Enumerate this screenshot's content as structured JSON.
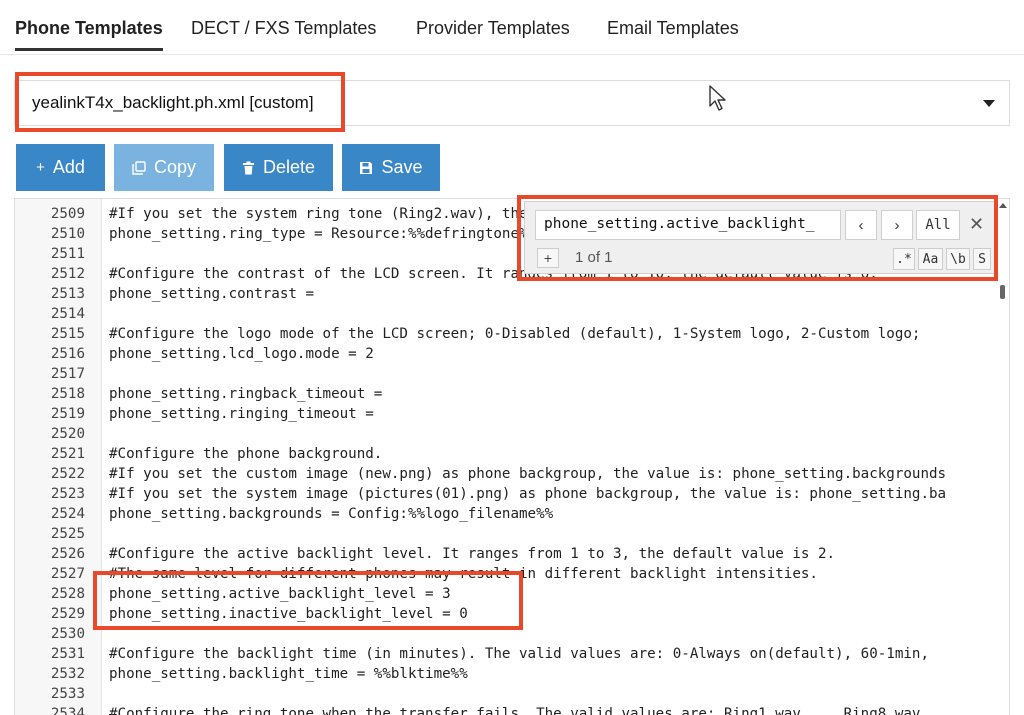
{
  "tabs": [
    {
      "label": "Phone Templates",
      "active": true
    },
    {
      "label": "DECT / FXS Templates"
    },
    {
      "label": "Provider Templates"
    },
    {
      "label": "Email Templates"
    }
  ],
  "template_select": {
    "value": "yealinkT4x_backlight.ph.xml [custom]"
  },
  "toolbar": {
    "add_label": "Add",
    "copy_label": "Copy",
    "delete_label": "Delete",
    "save_label": "Save"
  },
  "search": {
    "query": "phone_setting.active_backlight_",
    "prev_label": "‹",
    "next_label": "›",
    "all_label": "All",
    "close_label": "✕",
    "add_label": "+",
    "match_count": "1 of 1",
    "regex_label": ".*",
    "case_label": "Aa",
    "word_label": "\\b",
    "selection_label": "S"
  },
  "editor": {
    "lines": [
      {
        "n": "2509",
        "t": "#If you set the system ring tone (Ring2.wav), the value is: phone_setting.ring_type = Config:Ring2.wav"
      },
      {
        "n": "2510",
        "t": "phone_setting.ring_type = Resource:%%defringtone%%"
      },
      {
        "n": "2511",
        "t": ""
      },
      {
        "n": "2512",
        "t": "#Configure the contrast of the LCD screen. It ranges from 1 to 10, the default value is 6."
      },
      {
        "n": "2513",
        "t": "phone_setting.contrast ="
      },
      {
        "n": "2514",
        "t": ""
      },
      {
        "n": "2515",
        "t": "#Configure the logo mode of the LCD screen; 0-Disabled (default), 1-System logo, 2-Custom logo;"
      },
      {
        "n": "2516",
        "t": "phone_setting.lcd_logo.mode = 2"
      },
      {
        "n": "2517",
        "t": ""
      },
      {
        "n": "2518",
        "t": "phone_setting.ringback_timeout ="
      },
      {
        "n": "2519",
        "t": "phone_setting.ringing_timeout ="
      },
      {
        "n": "2520",
        "t": ""
      },
      {
        "n": "2521",
        "t": "#Configure the phone background."
      },
      {
        "n": "2522",
        "t": "#If you set the custom image (new.png) as phone backgroup, the value is: phone_setting.backgrounds"
      },
      {
        "n": "2523",
        "t": "#If you set the system image (pictures(01).png) as phone backgroup, the value is: phone_setting.ba"
      },
      {
        "n": "2524",
        "t": "phone_setting.backgrounds = Config:%%logo_filename%%"
      },
      {
        "n": "2525",
        "t": ""
      },
      {
        "n": "2526",
        "t": "#Configure the active backlight level. It ranges from 1 to 3, the default value is 2."
      },
      {
        "n": "2527",
        "t": "#The same level for different phones may result in different backlight intensities."
      },
      {
        "n": "2528",
        "t": "phone_setting.active_backlight_level = 3"
      },
      {
        "n": "2529",
        "t": "phone_setting.inactive_backlight_level = 0"
      },
      {
        "n": "2530",
        "t": ""
      },
      {
        "n": "2531",
        "t": "#Configure the backlight time (in minutes). The valid values are: 0-Always on(default), 60-1min,"
      },
      {
        "n": "2532",
        "t": "phone_setting.backlight_time = %%blktime%%"
      },
      {
        "n": "2533",
        "t": ""
      },
      {
        "n": "2534",
        "t": "#Configure the ring tone when the transfer fails. The valid values are: Ring1.wav.... Ring8.wav"
      }
    ]
  },
  "colors": {
    "button_primary": "#3a87c8",
    "button_disabled": "#7ab3df",
    "highlight": "#e8492a"
  }
}
